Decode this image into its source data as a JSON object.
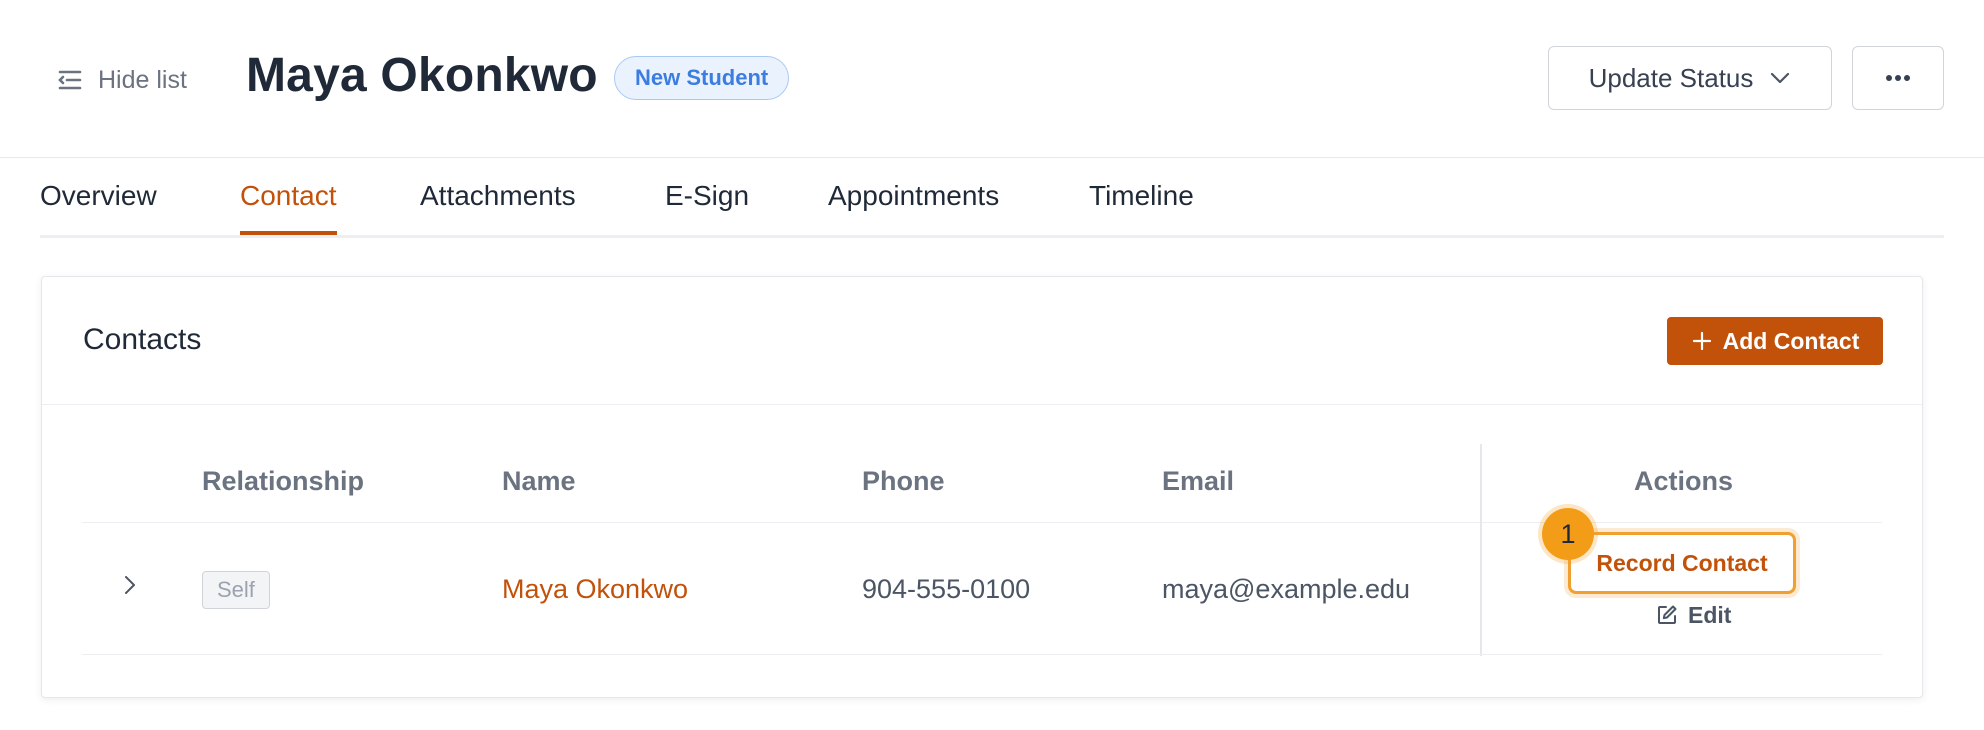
{
  "header": {
    "hide_list_label": "Hide list",
    "student_name": "Maya Okonkwo",
    "status_badge": "New Student",
    "update_status_label": "Update Status"
  },
  "tabs": [
    {
      "label": "Overview",
      "active": false
    },
    {
      "label": "Contact",
      "active": true
    },
    {
      "label": "Attachments",
      "active": false
    },
    {
      "label": "E-Sign",
      "active": false
    },
    {
      "label": "Appointments",
      "active": false
    },
    {
      "label": "Timeline",
      "active": false
    }
  ],
  "contacts": {
    "title": "Contacts",
    "add_button_label": "Add Contact",
    "columns": {
      "relationship": "Relationship",
      "name": "Name",
      "phone": "Phone",
      "email": "Email",
      "actions": "Actions"
    },
    "rows": [
      {
        "relationship": "Self",
        "name": "Maya Okonkwo",
        "phone": "904-555-0100",
        "email": "maya@example.edu",
        "primary_action": "Record Contact",
        "secondary_action": "Edit"
      }
    ]
  },
  "annotation": {
    "step_number": "1"
  },
  "colors": {
    "accent": "#c2510a",
    "badge_blue": "#3b7de0",
    "highlight": "#f39c18"
  }
}
